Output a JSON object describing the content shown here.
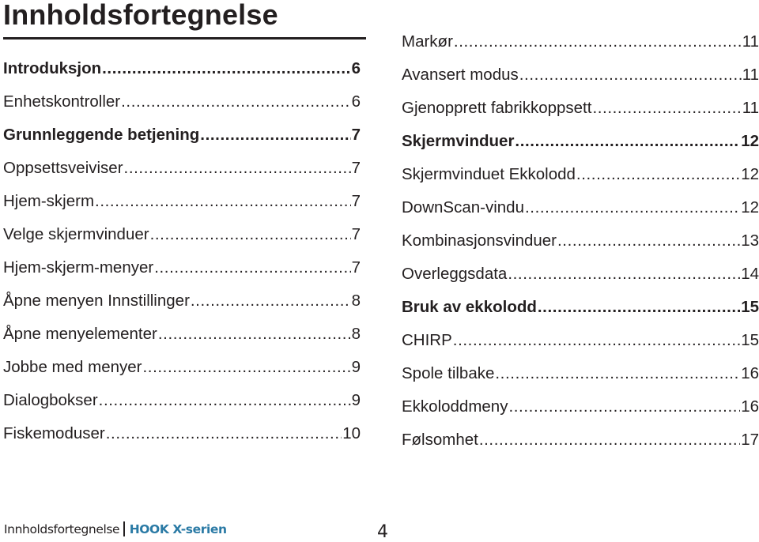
{
  "document": {
    "title": "Innholdsfortegnelse"
  },
  "toc": {
    "left": [
      {
        "label": "Introduksjon",
        "page": "6",
        "bold": true
      },
      {
        "label": "Enhetskontroller",
        "page": "6",
        "bold": false
      },
      {
        "label": "Grunnleggende betjening",
        "page": "7",
        "bold": true
      },
      {
        "label": "Oppsettsveiviser",
        "page": "7",
        "bold": false
      },
      {
        "label": "Hjem-skjerm",
        "page": "7",
        "bold": false
      },
      {
        "label": "Velge skjermvinduer",
        "page": "7",
        "bold": false
      },
      {
        "label": "Hjem-skjerm-menyer",
        "page": "7",
        "bold": false
      },
      {
        "label": "Åpne menyen Innstillinger",
        "page": "8",
        "bold": false
      },
      {
        "label": "Åpne menyelementer",
        "page": "8",
        "bold": false
      },
      {
        "label": "Jobbe med menyer",
        "page": "9",
        "bold": false
      },
      {
        "label": "Dialogbokser",
        "page": "9",
        "bold": false
      },
      {
        "label": "Fiskemoduser",
        "page": "10",
        "bold": false
      }
    ],
    "right": [
      {
        "label": "Markør",
        "page": "11",
        "bold": false
      },
      {
        "label": "Avansert modus",
        "page": "11",
        "bold": false
      },
      {
        "label": "Gjenopprett fabrikkoppsett",
        "page": "11",
        "bold": false
      },
      {
        "label": "Skjermvinduer",
        "page": "12",
        "bold": true
      },
      {
        "label": "Skjermvinduet Ekkolodd",
        "page": "12",
        "bold": false
      },
      {
        "label": "DownScan-vindu",
        "page": "12",
        "bold": false
      },
      {
        "label": "Kombinasjonsvinduer",
        "page": "13",
        "bold": false
      },
      {
        "label": "Overleggsdata",
        "page": "14",
        "bold": false
      },
      {
        "label": "Bruk av ekkolodd",
        "page": "15",
        "bold": true
      },
      {
        "label": "CHIRP",
        "page": "15",
        "bold": false
      },
      {
        "label": "Spole tilbake",
        "page": "16",
        "bold": false
      },
      {
        "label": "Ekkoloddmeny",
        "page": "16",
        "bold": false
      },
      {
        "label": "Følsomhet",
        "page": "17",
        "bold": false
      }
    ]
  },
  "footer": {
    "section": "Innholdsfortegnelse",
    "series": "HOOK X-serien",
    "series_color": "#2a7aa5",
    "page_number": "4"
  }
}
